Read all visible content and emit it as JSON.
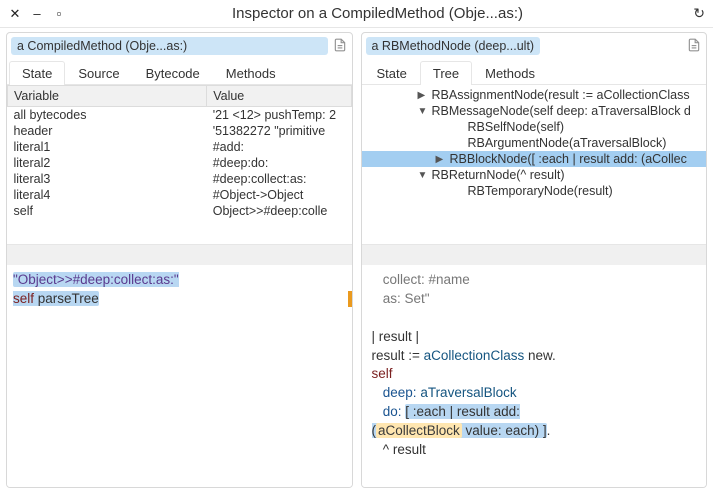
{
  "window": {
    "title": "Inspector on a CompiledMethod (Obje...as:)"
  },
  "left": {
    "header": "a CompiledMethod (Obje...as:)",
    "tabs": {
      "0": "State",
      "1": "Source",
      "2": "Bytecode",
      "3": "Methods",
      "active": "State"
    },
    "table": {
      "cols": {
        "0": "Variable",
        "1": "Value"
      },
      "rows": {
        "0": {
          "var": "all bytecodes",
          "val": "'21 <12> pushTemp: 2"
        },
        "1": {
          "var": "header",
          "val": "'51382272 \"primitive"
        },
        "2": {
          "var": "literal1",
          "val": "#add:"
        },
        "3": {
          "var": "literal2",
          "val": "#deep:do:"
        },
        "4": {
          "var": "literal3",
          "val": "#deep:collect:as:"
        },
        "5": {
          "var": "literal4",
          "val": "#Object->Object"
        },
        "6": {
          "var": "self",
          "val": "Object>>#deep:colle"
        }
      }
    },
    "code": {
      "line1_string": "\"Object>>#deep:collect:as:\"",
      "line2_self": "self",
      "line2_msg": "parseTree"
    }
  },
  "right": {
    "header": "a RBMethodNode (deep...ult)",
    "tabs": {
      "0": "State",
      "1": "Tree",
      "2": "Methods",
      "active": "Tree"
    },
    "tree": {
      "0": {
        "disclose": "▶",
        "label": "RBAssignmentNode(result := aCollectionClass"
      },
      "1": {
        "disclose": "▼",
        "label": "RBMessageNode(self deep: aTraversalBlock d"
      },
      "2": {
        "disclose": "",
        "label": "RBSelfNode(self)"
      },
      "3": {
        "disclose": "",
        "label": "RBArgumentNode(aTraversalBlock)"
      },
      "4": {
        "disclose": "▶",
        "label": "RBBlockNode([ :each | result add: (aCollec"
      },
      "5": {
        "disclose": "▼",
        "label": "RBReturnNode(^ result)"
      },
      "6": {
        "disclose": "",
        "label": "RBTemporaryNode(result)"
      }
    },
    "code": {
      "l1": "collect: #name",
      "l2": "as: Set\"",
      "l3": "| result |",
      "l4a": "result := ",
      "l4b": "aCollectionClass",
      "l4c": " new.",
      "l5": "self",
      "l6a": "deep: ",
      "l6b": "aTraversalBlock",
      "l7a": "do: ",
      "l7b": "[ :each | result add:",
      "l8a": "(",
      "l8b": "aCollectBlock",
      "l8c": " value: each) ]",
      "l8d": ".",
      "l9": "^ result"
    }
  }
}
